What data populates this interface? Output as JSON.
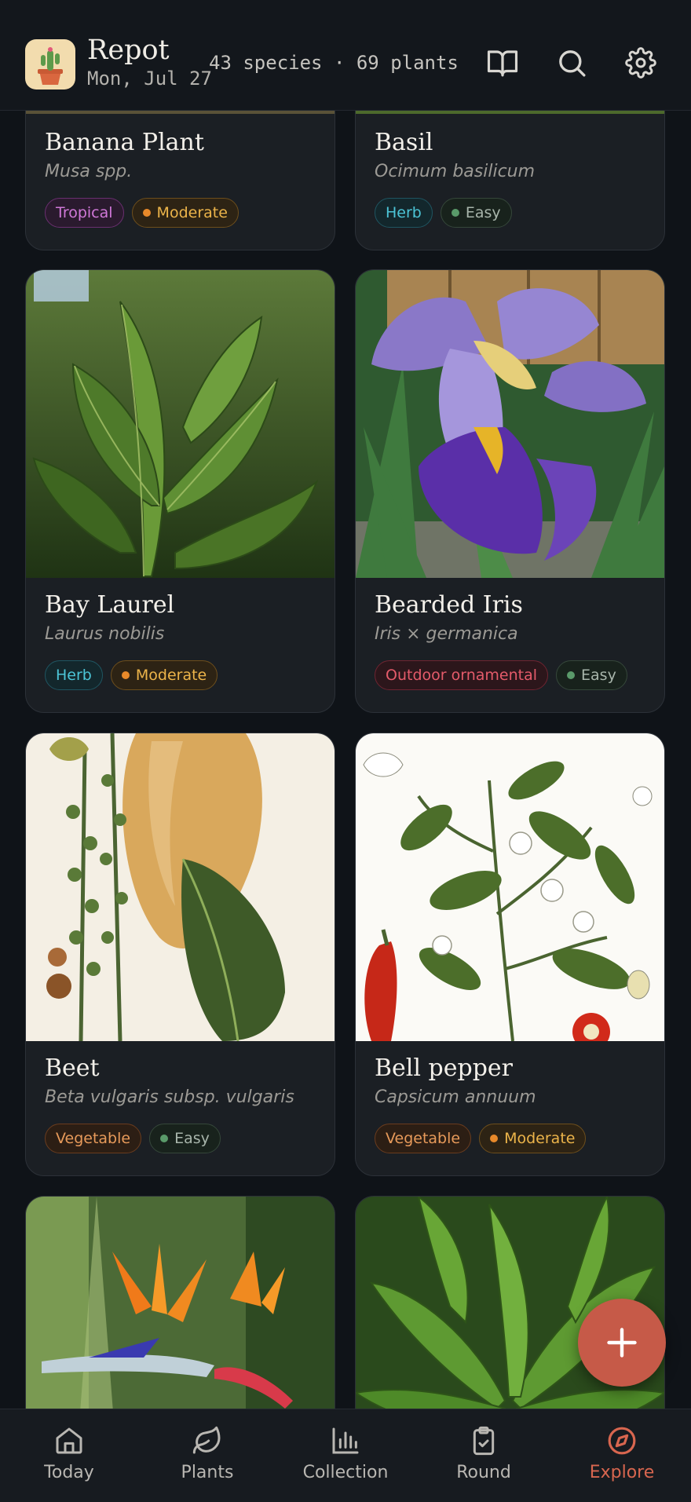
{
  "header": {
    "app_name": "Repot",
    "date": "Mon, Jul 27",
    "stats": "43 species · 69 plants"
  },
  "cards": [
    {
      "name": "Banana Plant",
      "scientific": "Musa spp.",
      "tags": [
        "Tropical",
        "Moderate"
      ]
    },
    {
      "name": "Basil",
      "scientific": "Ocimum basilicum",
      "tags": [
        "Herb",
        "Easy"
      ]
    },
    {
      "name": "Bay Laurel",
      "scientific": "Laurus nobilis",
      "tags": [
        "Herb",
        "Moderate"
      ]
    },
    {
      "name": "Bearded Iris",
      "scientific": "Iris × germanica",
      "tags": [
        "Outdoor ornamental",
        "Easy"
      ]
    },
    {
      "name": "Beet",
      "scientific": "Beta vulgaris subsp. vulgaris",
      "tags": [
        "Vegetable",
        "Easy"
      ]
    },
    {
      "name": "Bell pepper",
      "scientific": "Capsicum annuum",
      "tags": [
        "Vegetable",
        "Moderate"
      ]
    }
  ],
  "nav": [
    {
      "label": "Today",
      "icon": "home-icon"
    },
    {
      "label": "Plants",
      "icon": "leaf-icon"
    },
    {
      "label": "Collection",
      "icon": "bar-chart-icon"
    },
    {
      "label": "Round",
      "icon": "clipboard-check-icon"
    },
    {
      "label": "Explore",
      "icon": "compass-icon"
    }
  ],
  "active_nav": "Explore",
  "colors": {
    "accent": "#d8664f",
    "fab": "#c65a48",
    "background": "#0f1318",
    "card": "#1b1f24"
  }
}
